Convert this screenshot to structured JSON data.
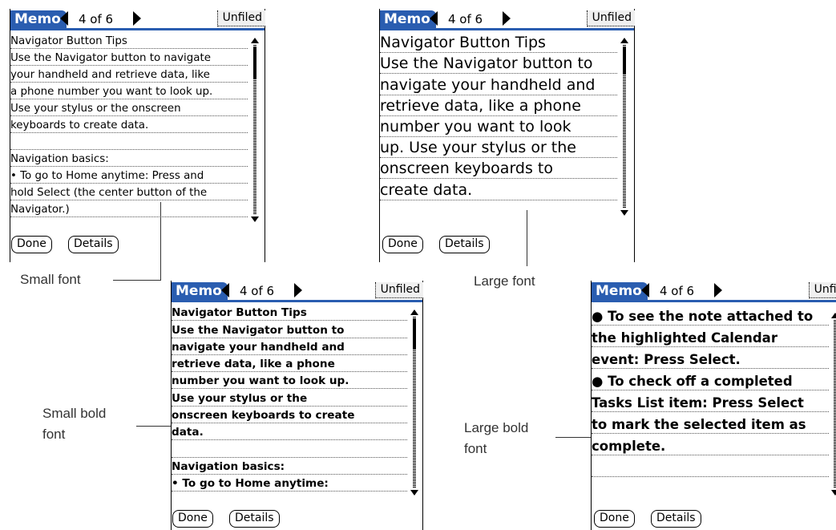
{
  "memo_app": {
    "tab_label": "Memo",
    "counter": "4 of 6",
    "category": "Unfiled",
    "done_button": "Done",
    "details_button": "Details"
  },
  "screens": {
    "small": {
      "lines": [
        "Navigator Button Tips",
        "Use the Navigator button to navigate",
        "your handheld and retrieve data, like",
        "a phone number you want to look up.",
        "Use your stylus or the onscreen",
        "keyboards to create data.",
        "",
        "Navigation basics:",
        "• To go to Home anytime: Press and",
        "hold Select (the center button of the",
        "Navigator.)"
      ]
    },
    "large": {
      "lines": [
        "Navigator Button Tips",
        "Use the Navigator button to",
        "navigate your handheld and",
        "retrieve data, like a phone",
        "number you want to look",
        "up. Use your stylus or the",
        "onscreen keyboards to",
        "create data."
      ]
    },
    "small_bold": {
      "lines": [
        "Navigator Button Tips",
        "Use the Navigator button to",
        "navigate your handheld and",
        "retrieve data, like a phone",
        "number you want to look up.",
        "Use your stylus or the",
        "onscreen keyboards to create",
        "data.",
        "",
        "Navigation basics:",
        "• To go to Home anytime:"
      ]
    },
    "large_bold": {
      "lines": [
        "● To see the note attached to",
        "the highlighted Calendar",
        "event: Press Select.",
        "● To check off a completed",
        "Tasks List item: Press Select",
        "to mark the selected item as",
        "complete.",
        ""
      ],
      "category": "Unfiled"
    }
  },
  "callouts": {
    "small": "Small font",
    "large": "Large font",
    "small_bold_1": "Small bold",
    "small_bold_2": "font",
    "large_bold_1": "Large bold",
    "large_bold_2": "font"
  }
}
